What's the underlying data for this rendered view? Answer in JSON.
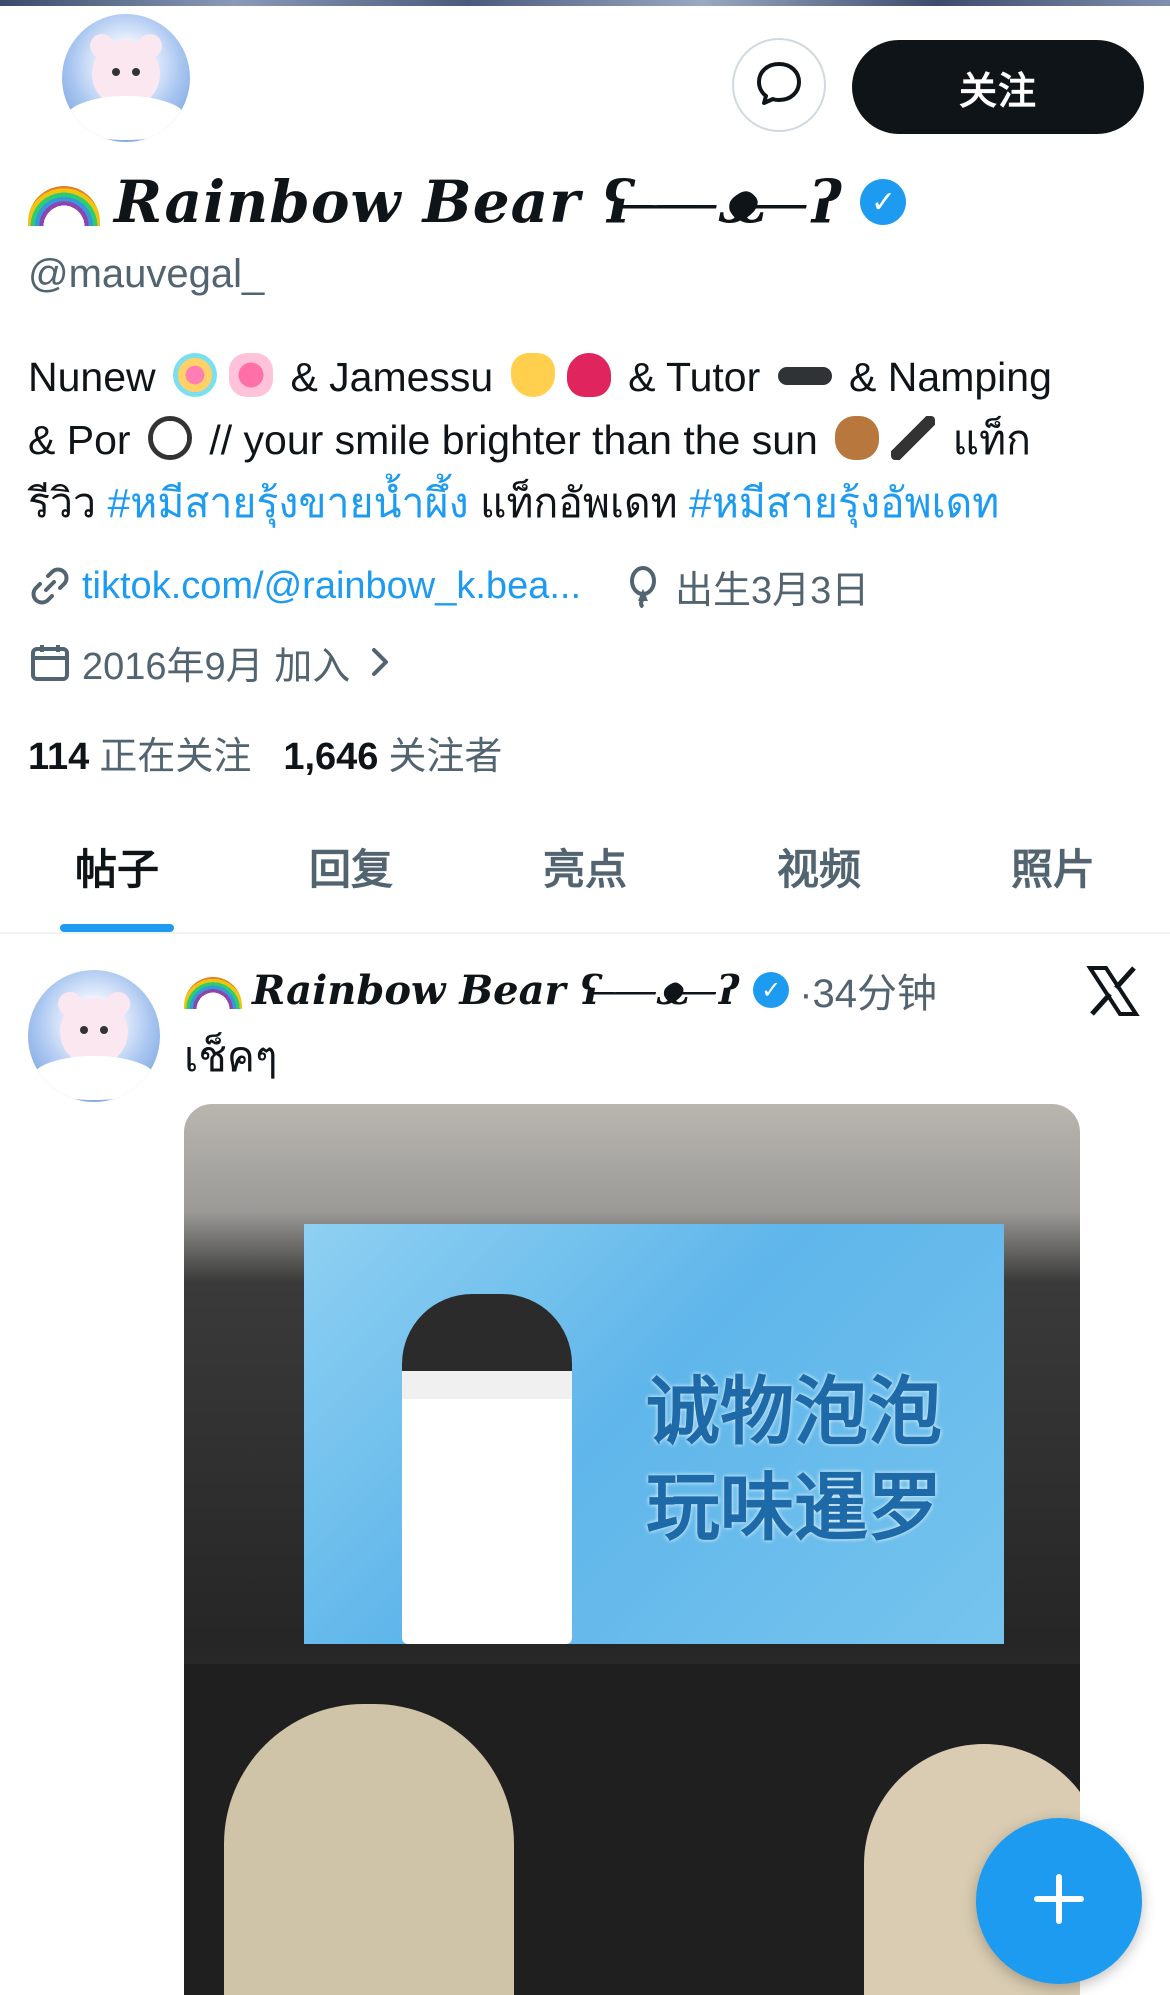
{
  "profile": {
    "display_name": "Rainbow Bear ʕ ̶̶̶̶̶̶̶ ̶ ̶̶̶̶ ̶̶̶ᴥ ̶̶̶̶ ̶̶̶̶̶̶̶ʔ",
    "handle": "@mauvegal_",
    "follow_label": "关注",
    "bio": {
      "line1_a": "Nunew",
      "line1_b": "& Jamessu",
      "line1_c": "& Tutor",
      "line1_d": "& Namping",
      "line2_a": "& Por",
      "line2_b": "// your smile brighter than the sun",
      "line2_c": "แท็ก",
      "line3_a": "รีวิว",
      "hashtag1": "#หมีสายรุ้งขายน้ำผึ้ง",
      "line3_b": "แท็กอัพเดท",
      "hashtag2": "#หมีสายรุ้งอัพเดท"
    },
    "link": "tiktok.com/@rainbow_k.bea...",
    "birthday": "出生3月3日",
    "joined": "2016年9月 加入",
    "following_count": "114",
    "following_label": "正在关注",
    "followers_count": "1,646",
    "followers_label": "关注者"
  },
  "tabs": [
    {
      "label": "帖子",
      "active": true
    },
    {
      "label": "回复",
      "active": false
    },
    {
      "label": "亮点",
      "active": false
    },
    {
      "label": "视频",
      "active": false
    },
    {
      "label": "照片",
      "active": false
    }
  ],
  "post": {
    "author": "Rainbow Bear ʕ ̶̶̶̶̶̶̶ ̶ ̶̶̶̶ ̶̶̶ᴥ ̶̶̶̶ ̶̶̶̶̶̶̶ʔ",
    "time": "·34分钟",
    "text": "เช็คๆ",
    "image_caption_line1": "诚物泡泡",
    "image_caption_line2": "玩味暹罗"
  },
  "colors": {
    "accent": "#1d9bf0",
    "text_primary": "#0f1419",
    "text_secondary": "#536471"
  },
  "icons": [
    "message-icon",
    "verified-icon",
    "link-icon",
    "balloon-icon",
    "calendar-icon",
    "chevron-right-icon",
    "x-logo-icon",
    "plus-icon"
  ]
}
